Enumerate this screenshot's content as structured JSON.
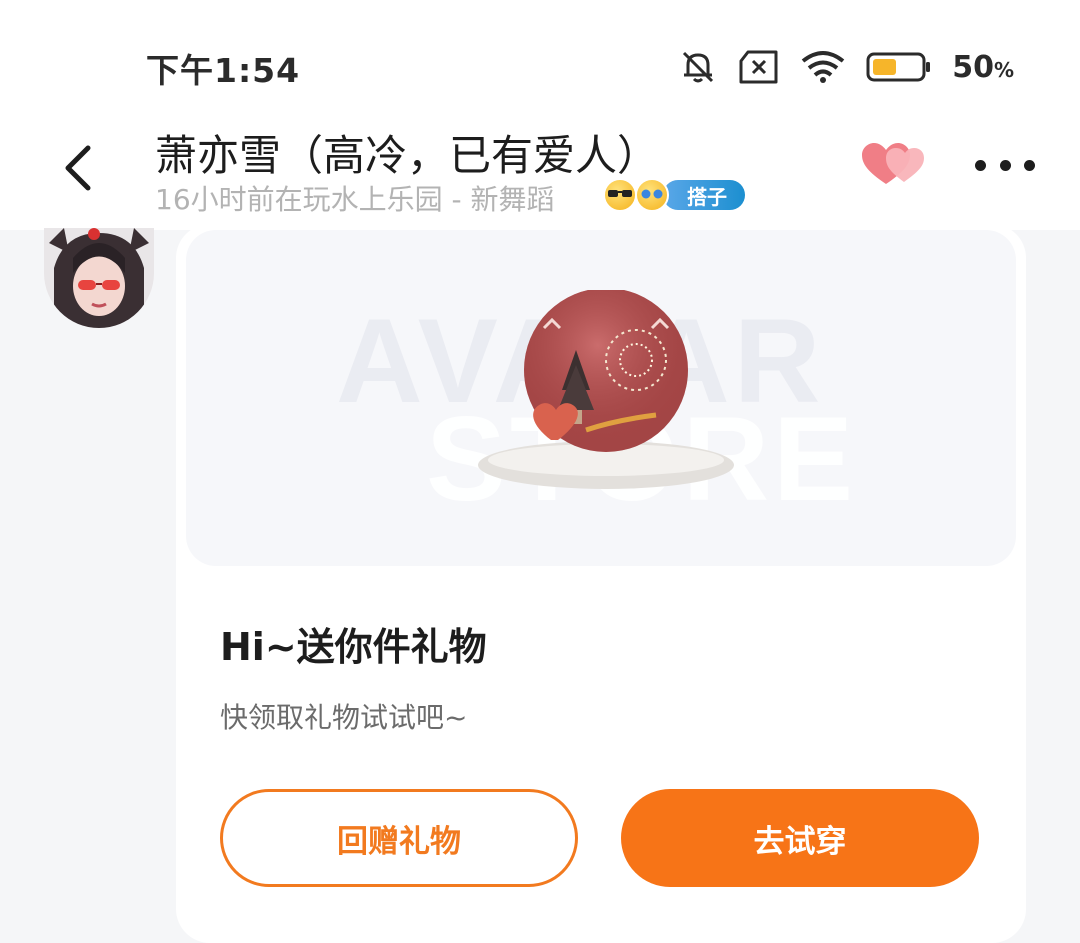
{
  "status_bar": {
    "time": "下午1:54",
    "battery_percent": "50",
    "battery_unit": "%",
    "battery_level": 0.5,
    "icons": [
      "bell-muted-icon",
      "sim-x-icon",
      "wifi-icon",
      "battery-icon"
    ]
  },
  "header": {
    "title": "萧亦雪（高冷，已有爱人）",
    "subtitle": "16小时前在玩水上乐园 - 新舞蹈",
    "relation_badge": "搭子",
    "icons": [
      "back-arrow-icon",
      "hearts-icon",
      "more-icon"
    ]
  },
  "gift_card": {
    "title": "Hi~送你件礼物",
    "description": "快领取礼物试试吧~",
    "return_gift_label": "回赠礼物",
    "try_on_label": "去试穿",
    "watermark_line1": "AVATAR",
    "watermark_line2": "STORE"
  },
  "colors": {
    "accent_orange": "#f77417",
    "badge_blue": "#1c8fd0",
    "heart_pink": "#f07e86"
  }
}
